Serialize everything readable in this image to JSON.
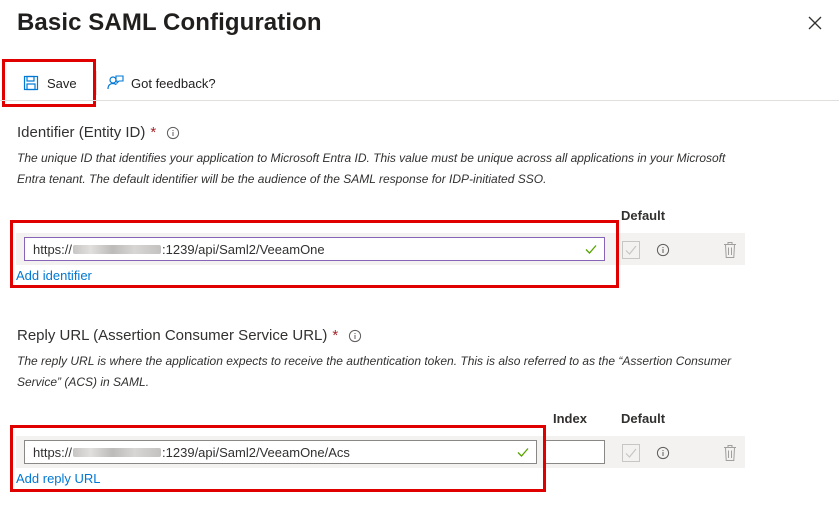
{
  "header": {
    "title": "Basic SAML Configuration"
  },
  "toolbar": {
    "save_label": "Save",
    "feedback_label": "Got feedback?"
  },
  "identifier": {
    "label": "Identifier (Entity ID)",
    "required_mark": "*",
    "description": "The unique ID that identifies your application to Microsoft Entra ID. This value must be unique across all applications in your Microsoft Entra tenant. The default identifier will be the audience of the SAML response for IDP-initiated SSO.",
    "col_default": "Default",
    "value_prefix": "https://",
    "value_suffix": ":1239/api/Saml2/VeeamOne",
    "add_link": "Add identifier"
  },
  "reply_url": {
    "label": "Reply URL (Assertion Consumer Service URL)",
    "required_mark": "*",
    "description": "The reply URL is where the application expects to receive the authentication token. This is also referred to as the “Assertion Consumer Service” (ACS) in SAML.",
    "col_index": "Index",
    "col_default": "Default",
    "value_prefix": "https://",
    "value_suffix": ":1239/api/Saml2/VeeamOne/Acs",
    "index_value": "",
    "add_link": "Add reply URL"
  },
  "colors": {
    "highlight": "#e00000",
    "link": "#0078d4",
    "required": "#a4262c",
    "valid": "#57a300"
  },
  "icons": [
    "close-icon",
    "save-icon",
    "feedback-icon",
    "info-icon",
    "checkmark-icon",
    "checkbox-icon",
    "trash-icon"
  ]
}
